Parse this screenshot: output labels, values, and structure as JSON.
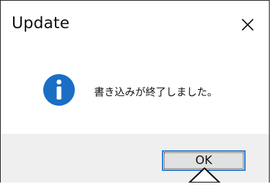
{
  "window": {
    "title": "Update"
  },
  "titlebar": {
    "close_icon": "close-icon"
  },
  "message": {
    "icon": "info-icon",
    "text": "書き込みが終了しました。"
  },
  "buttons": {
    "ok_label": "OK"
  },
  "colors": {
    "info_icon": "#1a6fc4",
    "ok_border": "#2d7bd0",
    "footer_bg": "#efefef"
  }
}
